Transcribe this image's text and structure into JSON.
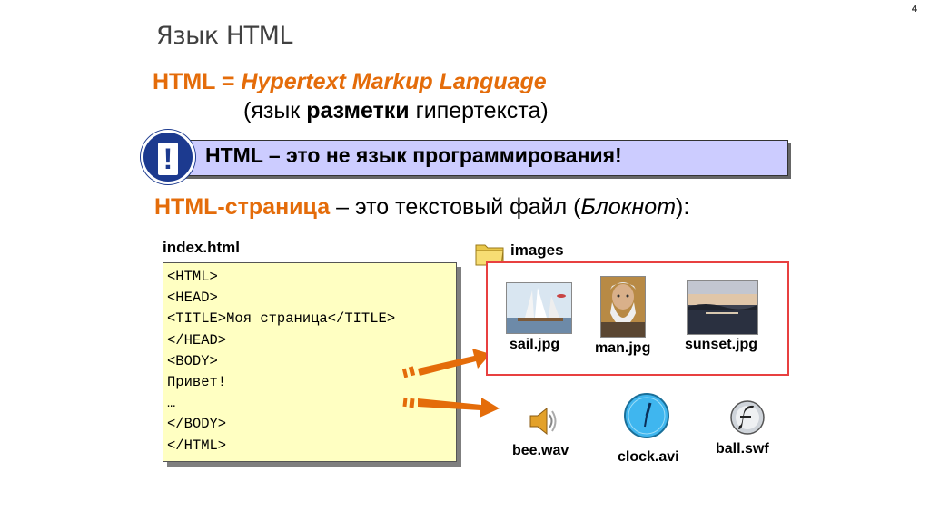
{
  "page_number": "4",
  "title": "Язык HTML",
  "definition": {
    "abbr": "HTML",
    "equals": " = ",
    "expansion": "Hypertext Markup Language",
    "open": "(язык ",
    "bold_word": "разметки",
    "rest": " гипертекста)"
  },
  "note": {
    "icon": "!",
    "text": "HTML – это не язык программирования!"
  },
  "file_desc": {
    "term": "HTML-страница",
    "middle": " – это текстовый файл (",
    "app": "Блокнот",
    "end": "):"
  },
  "code_file": {
    "name": "index.html",
    "lines": [
      "<HTML>",
      "<HEAD>",
      "<TITLE>Моя страница</TITLE>",
      "</HEAD>",
      "<BODY>",
      "Привет!",
      "…",
      "</BODY>",
      "</HTML>"
    ]
  },
  "folder": {
    "icon": "folder-icon",
    "label": "images",
    "files": [
      "sail.jpg",
      "man.jpg",
      "sunset.jpg"
    ]
  },
  "media": [
    "bee.wav",
    "clock.avi",
    "ball.swf"
  ],
  "colors": {
    "accent_orange": "#e46c0a",
    "note_bg": "#ccccff",
    "badge_blue": "#1c3a8f",
    "code_bg": "#ffffc2",
    "images_border": "#e84040"
  }
}
